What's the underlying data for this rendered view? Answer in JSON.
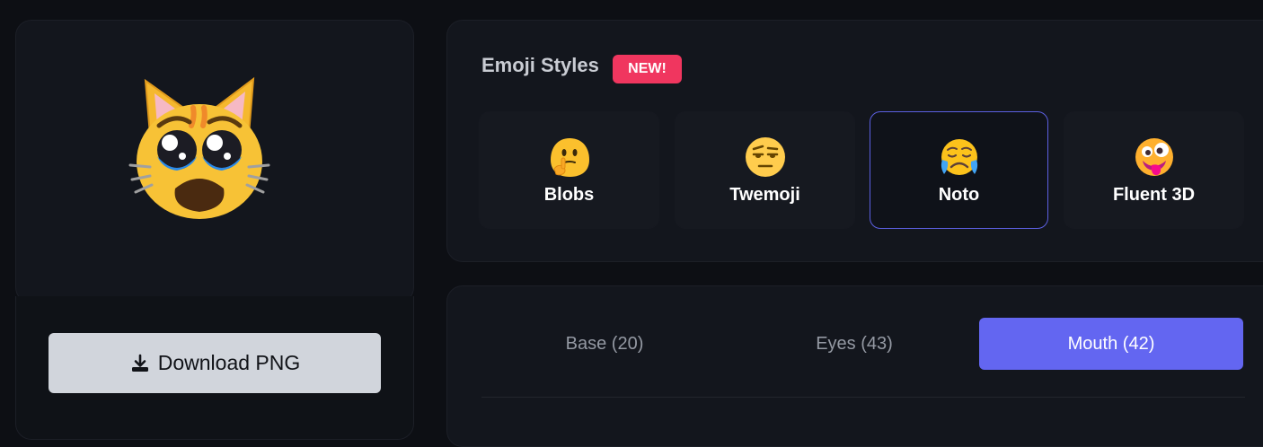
{
  "preview": {
    "emoji_icon": "crying-cat-icon",
    "download_label": "Download PNG",
    "download_icon": "download-icon"
  },
  "styles": {
    "title": "Emoji Styles",
    "badge": "NEW!",
    "items": [
      {
        "label": "Blobs",
        "icon": "thinking-blob-icon",
        "selected": false
      },
      {
        "label": "Twemoji",
        "icon": "raised-eyebrow-face-icon",
        "selected": false
      },
      {
        "label": "Noto",
        "icon": "crying-face-icon",
        "selected": true
      },
      {
        "label": "Fluent 3D",
        "icon": "zany-face-icon",
        "selected": false
      }
    ]
  },
  "parts": {
    "tabs": [
      {
        "label": "Base (20)",
        "active": false
      },
      {
        "label": "Eyes (43)",
        "active": false
      },
      {
        "label": "Mouth (42)",
        "active": true
      }
    ]
  },
  "colors": {
    "accent": "#6366f1",
    "badge": "#f0365f",
    "selected_border": "#5b5fe0",
    "background": "#0d0f14"
  }
}
